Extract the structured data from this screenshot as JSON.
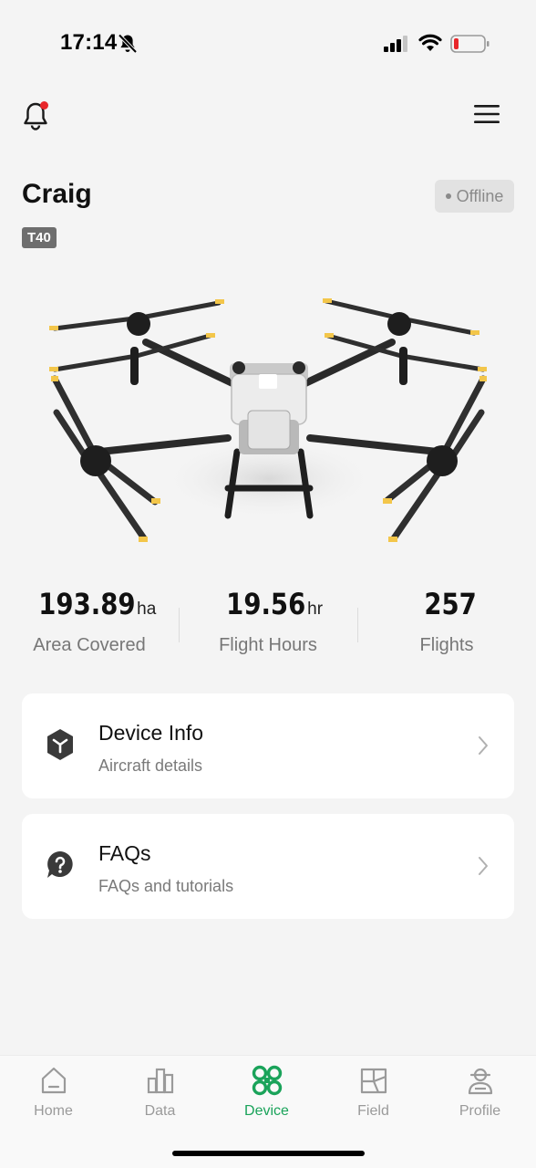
{
  "status_bar": {
    "time": "17:14",
    "icons": [
      "bell-slash-icon",
      "cellular-signal-icon",
      "wifi-icon",
      "battery-low-icon"
    ]
  },
  "header": {
    "notification_icon": "bell-icon",
    "has_unread": true,
    "menu_icon": "hamburger-menu-icon"
  },
  "device": {
    "name": "Craig",
    "status": "Offline",
    "model": "T40",
    "image": "agricultural-drone-image"
  },
  "stats": [
    {
      "value": "193.89",
      "unit": "ha",
      "label": "Area Covered"
    },
    {
      "value": "19.56",
      "unit": "hr",
      "label": "Flight Hours"
    },
    {
      "value": "257",
      "unit": "",
      "label": "Flights"
    }
  ],
  "cards": [
    {
      "title": "Device Info",
      "subtitle": "Aircraft details",
      "icon": "cube-icon"
    },
    {
      "title": "FAQs",
      "subtitle": "FAQs and tutorials",
      "icon": "help-bubble-icon"
    }
  ],
  "tabs": [
    {
      "label": "Home",
      "icon": "home-icon",
      "active": false
    },
    {
      "label": "Data",
      "icon": "bar-chart-icon",
      "active": false
    },
    {
      "label": "Device",
      "icon": "drone-icon",
      "active": true
    },
    {
      "label": "Field",
      "icon": "field-map-icon",
      "active": false
    },
    {
      "label": "Profile",
      "icon": "pilot-profile-icon",
      "active": false
    }
  ],
  "colors": {
    "accent": "#1aa35a",
    "background": "#f4f4f4",
    "notification_dot": "#e8262a",
    "battery_low": "#e8262a"
  }
}
